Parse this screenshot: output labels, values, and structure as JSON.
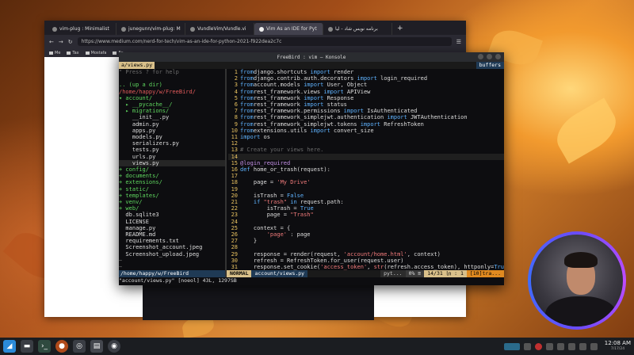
{
  "browser": {
    "tabs": [
      {
        "label": "vim-plug : Minimalist"
      },
      {
        "label": "junegunn/vim-plug: M"
      },
      {
        "label": "VundleVim/Vundle.vi"
      },
      {
        "label": "Vim As an IDE for Pyt"
      },
      {
        "label": "برنامه نویس شاد - لیا"
      }
    ],
    "url": "https://www.medium.com/nerd-for-tech/vim-as-an-ide-for-python-2021-f922dea2c7c",
    "bookmarks": [
      "Me",
      "Tax",
      "Mostafa",
      "Ex"
    ]
  },
  "konsole": {
    "title": "FreeBird : vim — Konsole",
    "buffer_tab": "a/views.py",
    "buffers_label": "buffers",
    "tree_lines": [
      {
        "text": "\" Press ? for help",
        "cls": "com"
      },
      {
        "text": "",
        "cls": ""
      },
      {
        "text": ".. (up a dir)",
        "cls": "grn"
      },
      {
        "text": "/home/happy/w/FreeBird/",
        "cls": "red"
      },
      {
        "text": "▾ account/",
        "cls": "grn"
      },
      {
        "text": "  ▸ __pycache__/",
        "cls": "grn"
      },
      {
        "text": "  ▸ migrations/",
        "cls": "grn"
      },
      {
        "text": "    __init__.py",
        "cls": ""
      },
      {
        "text": "    admin.py",
        "cls": ""
      },
      {
        "text": "    apps.py",
        "cls": ""
      },
      {
        "text": "    models.py",
        "cls": ""
      },
      {
        "text": "    serializers.py",
        "cls": ""
      },
      {
        "text": "    tests.py",
        "cls": ""
      },
      {
        "text": "    urls.py",
        "cls": ""
      },
      {
        "text": "    views.py",
        "cls": ""
      },
      {
        "text": "+ config/",
        "cls": "grn"
      },
      {
        "text": "+ documents/",
        "cls": "grn"
      },
      {
        "text": "+ extensions/",
        "cls": "grn"
      },
      {
        "text": "+ static/",
        "cls": "grn"
      },
      {
        "text": "+ templates/",
        "cls": "grn"
      },
      {
        "text": "+ venv/",
        "cls": "grn"
      },
      {
        "text": "+ web/",
        "cls": "grn"
      },
      {
        "text": "  db.sqlite3",
        "cls": ""
      },
      {
        "text": "  LICENSE",
        "cls": ""
      },
      {
        "text": "  manage.py",
        "cls": ""
      },
      {
        "text": "  README.md",
        "cls": ""
      },
      {
        "text": "  requirements.txt",
        "cls": ""
      },
      {
        "text": "  Screenshot_account.jpeg",
        "cls": ""
      },
      {
        "text": "  Screenshot_upload.jpeg",
        "cls": ""
      },
      {
        "text": "~",
        "cls": "com"
      },
      {
        "text": "~",
        "cls": "com"
      }
    ],
    "code_lines": [
      {
        "n": "1",
        "parts": [
          [
            "kw",
            "from"
          ],
          [
            "",
            "django.shortcuts "
          ],
          [
            "kw",
            "import"
          ],
          [
            "",
            " render"
          ]
        ]
      },
      {
        "n": "2",
        "parts": [
          [
            "kw",
            "from"
          ],
          [
            "",
            "django.contrib.auth.decorators "
          ],
          [
            "kw",
            "import"
          ],
          [
            "",
            " login_required"
          ]
        ]
      },
      {
        "n": "3",
        "parts": [
          [
            "kw",
            "from"
          ],
          [
            "",
            "account.models "
          ],
          [
            "kw",
            "import"
          ],
          [
            "",
            " User, Object"
          ]
        ]
      },
      {
        "n": "4",
        "parts": [
          [
            "kw",
            "from"
          ],
          [
            "",
            "rest_framework.views "
          ],
          [
            "kw",
            "import"
          ],
          [
            "",
            " APIView"
          ]
        ]
      },
      {
        "n": "5",
        "parts": [
          [
            "kw",
            "from"
          ],
          [
            "",
            "rest_framework "
          ],
          [
            "kw",
            "import"
          ],
          [
            "",
            " Response"
          ]
        ]
      },
      {
        "n": "6",
        "parts": [
          [
            "kw",
            "from"
          ],
          [
            "",
            "rest_framework "
          ],
          [
            "kw",
            "import"
          ],
          [
            "",
            " status"
          ]
        ]
      },
      {
        "n": "7",
        "parts": [
          [
            "kw",
            "from"
          ],
          [
            "",
            "rest_framework.permissions "
          ],
          [
            "kw",
            "import"
          ],
          [
            "",
            " IsAuthenticated"
          ]
        ]
      },
      {
        "n": "8",
        "parts": [
          [
            "kw",
            "from"
          ],
          [
            "",
            "rest_framework_simplejwt.authentication "
          ],
          [
            "kw",
            "import"
          ],
          [
            "",
            " JWTAuthentication"
          ]
        ]
      },
      {
        "n": "9",
        "parts": [
          [
            "kw",
            "from"
          ],
          [
            "",
            "rest_framework_simplejwt.tokens "
          ],
          [
            "kw",
            "import"
          ],
          [
            "",
            " RefreshToken"
          ]
        ]
      },
      {
        "n": "10",
        "parts": [
          [
            "kw",
            "from"
          ],
          [
            "",
            "extensions.utils "
          ],
          [
            "kw",
            "import"
          ],
          [
            "",
            " convert_size"
          ]
        ]
      },
      {
        "n": "11",
        "parts": [
          [
            "kw",
            "import"
          ],
          [
            "",
            " os"
          ]
        ]
      },
      {
        "n": "12",
        "parts": []
      },
      {
        "n": "13",
        "parts": [
          [
            "com",
            "# Create your views here."
          ]
        ]
      },
      {
        "n": "14",
        "parts": []
      },
      {
        "n": "15",
        "parts": [
          [
            "dec",
            "@login_required"
          ]
        ]
      },
      {
        "n": "16",
        "parts": [
          [
            "kw",
            "def"
          ],
          [
            "",
            " home_or_trash(request):"
          ]
        ]
      },
      {
        "n": "17",
        "parts": []
      },
      {
        "n": "18",
        "parts": [
          [
            "",
            "    page = "
          ],
          [
            "str",
            "'My Drive'"
          ]
        ]
      },
      {
        "n": "19",
        "parts": []
      },
      {
        "n": "20",
        "parts": [
          [
            "",
            "    isTrash = "
          ],
          [
            "kw",
            "False"
          ]
        ]
      },
      {
        "n": "21",
        "parts": [
          [
            "",
            "    "
          ],
          [
            "kw",
            "if"
          ],
          [
            "",
            " "
          ],
          [
            "str",
            "\"trash\""
          ],
          [
            "",
            " "
          ],
          [
            "kw",
            "in"
          ],
          [
            "",
            " request.path:"
          ]
        ]
      },
      {
        "n": "22",
        "parts": [
          [
            "",
            "        isTrash = "
          ],
          [
            "kw",
            "True"
          ]
        ]
      },
      {
        "n": "23",
        "parts": [
          [
            "",
            "        page = "
          ],
          [
            "str",
            "\"Trash\""
          ]
        ]
      },
      {
        "n": "24",
        "parts": []
      },
      {
        "n": "25",
        "parts": [
          [
            "",
            "    context = {"
          ]
        ]
      },
      {
        "n": "26",
        "parts": [
          [
            "",
            "        "
          ],
          [
            "str",
            "'page'"
          ],
          [
            "",
            " : page"
          ]
        ]
      },
      {
        "n": "27",
        "parts": [
          [
            "",
            "    }"
          ]
        ]
      },
      {
        "n": "28",
        "parts": []
      },
      {
        "n": "29",
        "parts": [
          [
            "",
            "    response = render(request, "
          ],
          [
            "str",
            "'account/home.html'"
          ],
          [
            "",
            ", context)"
          ]
        ]
      },
      {
        "n": "30",
        "parts": [
          [
            "",
            "    refresh = RefreshToken.for_user(request.user)"
          ]
        ]
      },
      {
        "n": "31",
        "parts": [
          [
            "",
            "    response.set_cookie("
          ],
          [
            "str",
            "'access_token'"
          ],
          [
            "",
            ", "
          ],
          [
            "str",
            "str"
          ],
          [
            "",
            "(refresh.access_token), httponly="
          ],
          [
            "kw",
            "True"
          ],
          [
            "",
            ")"
          ]
        ]
      }
    ],
    "status": {
      "tree_path": "/home/happy/w/FreeBird",
      "mode": "NORMAL",
      "file": "account/views.py",
      "filetype": "pyt...",
      "percent": "0% ≡",
      "position": "14/31 ㏑ : 1",
      "warn": "[10]tra..."
    },
    "message": "\"account/views.py\" [noeol] 43L, 1297SB"
  },
  "taskbar": {
    "time": "12:08 AM",
    "date": "7/17/24"
  }
}
